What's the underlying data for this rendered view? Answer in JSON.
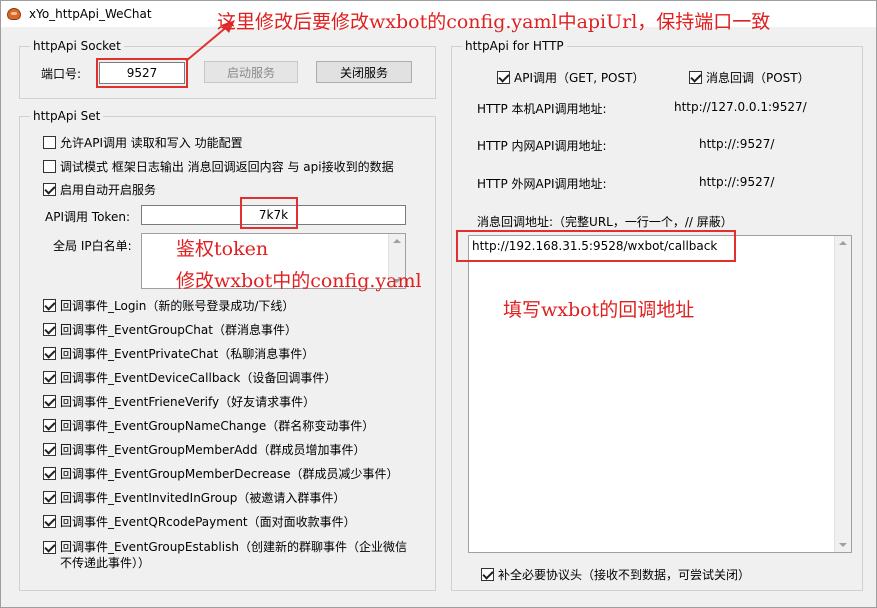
{
  "window": {
    "title": "xYo_httpApi_WeChat"
  },
  "socket": {
    "legend": "httpApi Socket",
    "port_label": "端口号:",
    "port_value": "9527",
    "start_button": "启动服务",
    "stop_button": "关闭服务"
  },
  "set": {
    "legend": "httpApi Set",
    "checkboxes": [
      {
        "label": "允许API调用 读取和写入 功能配置",
        "checked": false
      },
      {
        "label": "调试模式  框架日志输出 消息回调返回内容 与 api接收到的数据",
        "checked": false
      },
      {
        "label": "启用自动开启服务",
        "checked": true
      }
    ],
    "token_label": "API调用 Token:",
    "token_value": "7k7k",
    "whitelist_label": "全局 IP白名单:",
    "events": [
      {
        "label": "回调事件_Login（新的账号登录成功/下线）",
        "checked": true
      },
      {
        "label": "回调事件_EventGroupChat（群消息事件）",
        "checked": true
      },
      {
        "label": "回调事件_EventPrivateChat（私聊消息事件）",
        "checked": true
      },
      {
        "label": "回调事件_EventDeviceCallback（设备回调事件）",
        "checked": true
      },
      {
        "label": "回调事件_EventFrieneVerify（好友请求事件）",
        "checked": true
      },
      {
        "label": "回调事件_EventGroupNameChange（群名称变动事件）",
        "checked": true
      },
      {
        "label": "回调事件_EventGroupMemberAdd（群成员增加事件）",
        "checked": true
      },
      {
        "label": "回调事件_EventGroupMemberDecrease（群成员减少事件）",
        "checked": true
      },
      {
        "label": "回调事件_EventInvitedInGroup（被邀请入群事件）",
        "checked": true
      },
      {
        "label": "回调事件_EventQRcodePayment（面对面收款事件）",
        "checked": true
      }
    ],
    "last_event": {
      "line1": "回调事件_EventGroupEstablish（创建新的群聊事件（企业微信",
      "line2": "不传递此事件））",
      "checked": true
    }
  },
  "http": {
    "legend": "httpApi for HTTP",
    "api_call": {
      "label": "API调用（GET, POST）",
      "checked": true
    },
    "msg_callback": {
      "label": "消息回调（POST）",
      "checked": true
    },
    "local_label": "HTTP 本机API调用地址:",
    "local_value": "http://127.0.0.1:9527/",
    "lan_label": "HTTP 内网API调用地址:",
    "lan_value": "http://:9527/",
    "wan_label": "HTTP 外网API调用地址:",
    "wan_value": "http://:9527/",
    "callback_label": "消息回调地址:（完整URL，一行一个，// 屏蔽）",
    "callback_value": "http://192.168.31.5:9528/wxbot/callback",
    "patch_header": {
      "label": "补全必要协议头（接收不到数据，可尝试关闭）",
      "checked": true
    }
  },
  "annotations": {
    "top": "这里修改后要修改wxbot的config.yaml中apiUrl，保持端口一致",
    "token_line1": "鉴权token",
    "token_line2": "修改wxbot中的config.yaml",
    "callback": "填写wxbot的回调地址",
    "color": "#e02020"
  }
}
